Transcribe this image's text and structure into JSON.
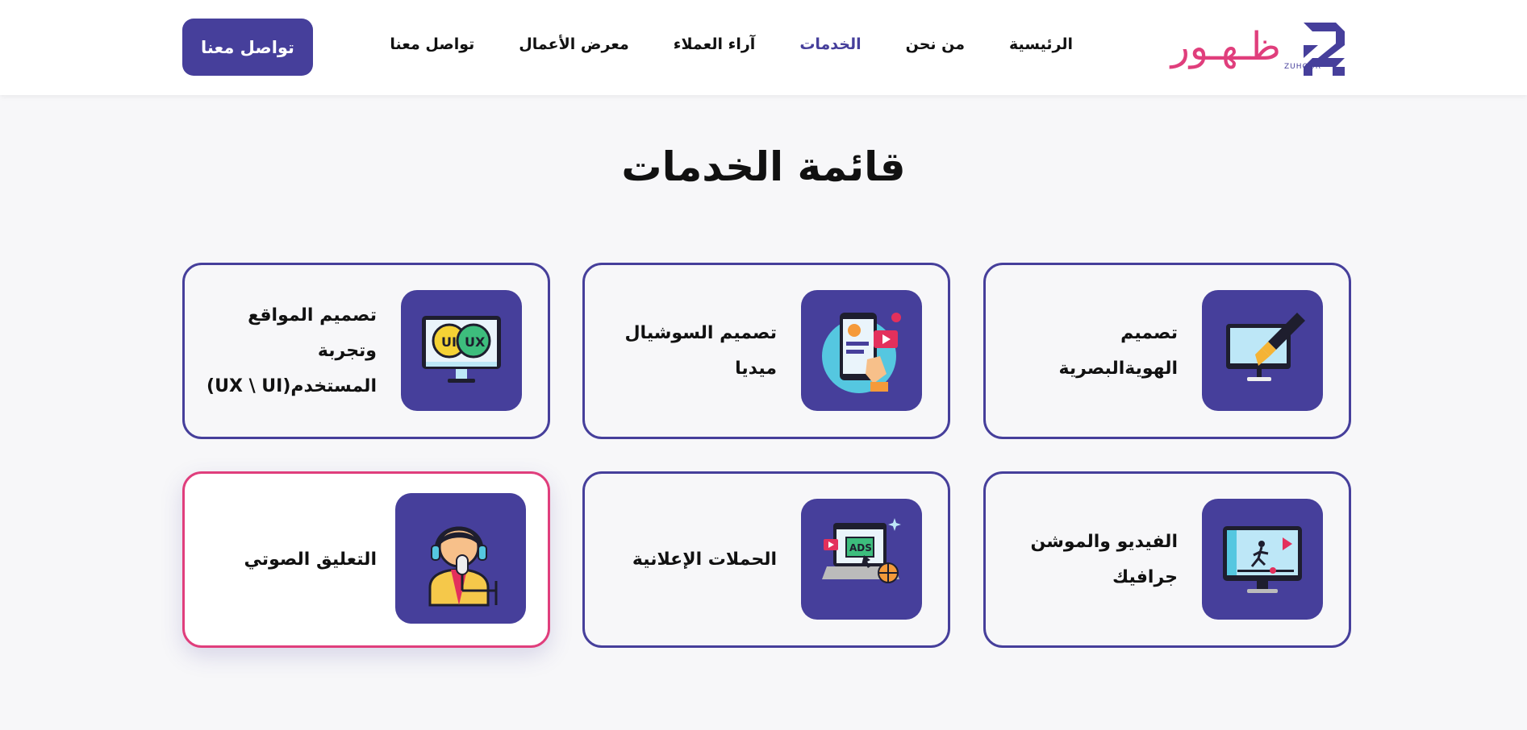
{
  "header": {
    "logo_text": "ظـهـور",
    "logo_subtext": "ZUHOOR",
    "cta_label": "تواصل معنا",
    "nav": [
      {
        "label": "الرئيسية",
        "active": false
      },
      {
        "label": "من نحن",
        "active": false
      },
      {
        "label": "الخدمات",
        "active": true
      },
      {
        "label": "آراء العملاء",
        "active": false
      },
      {
        "label": "معرض الأعمال",
        "active": false
      },
      {
        "label": "تواصل معنا",
        "active": false
      }
    ]
  },
  "main": {
    "title": "قائمة الخدمات",
    "services": [
      {
        "label": "تصميم الهويةالبصرية",
        "icon": "brand-identity-icon",
        "highlight": false
      },
      {
        "label": "تصميم السوشيال ميديا",
        "icon": "social-media-icon",
        "highlight": false
      },
      {
        "label": "تصميم المواقع وتجربة المستخدم(UX \\ UI)",
        "icon": "ui-ux-icon",
        "highlight": false
      },
      {
        "label": "الفيديو والموشن جرافيك",
        "icon": "motion-graphics-icon",
        "highlight": false
      },
      {
        "label": "الحملات الإعلانية",
        "icon": "ads-campaign-icon",
        "highlight": false
      },
      {
        "label": "التعليق الصوتي",
        "icon": "voice-over-icon",
        "highlight": true
      }
    ]
  },
  "colors": {
    "primary": "#463f9b",
    "accent": "#e03e7c",
    "background": "#f7f7f9"
  }
}
